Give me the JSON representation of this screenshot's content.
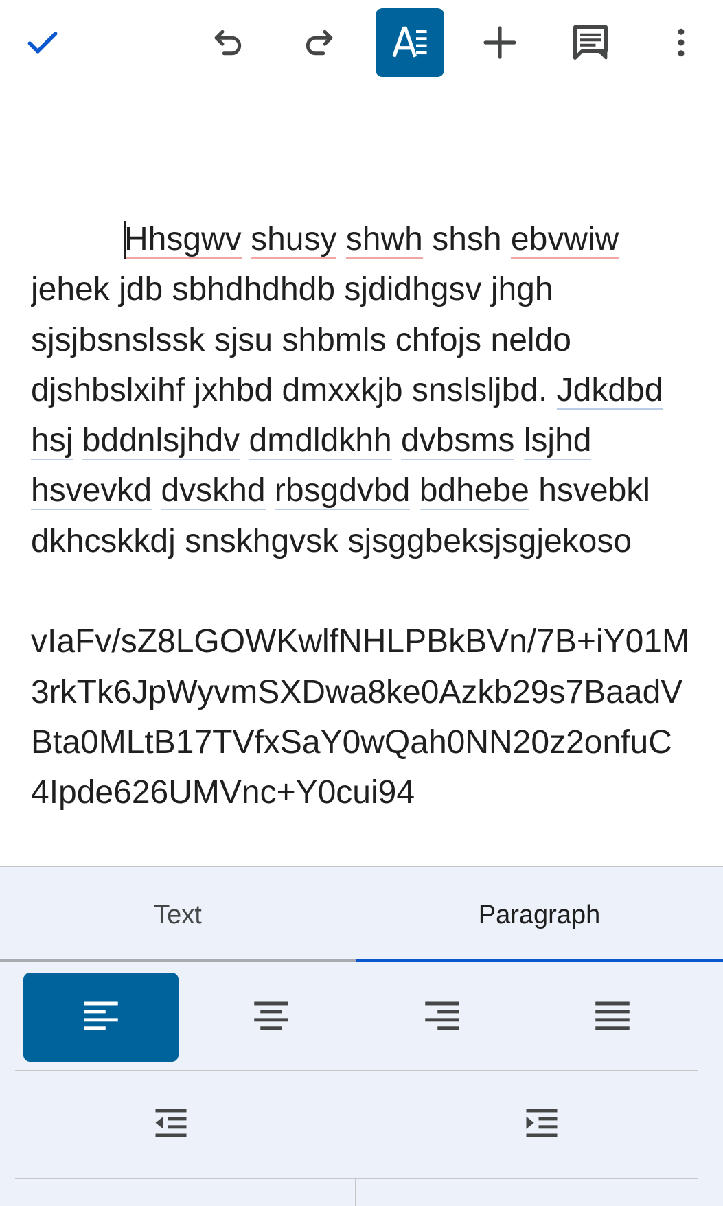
{
  "toolbar": {
    "icons": [
      "check-icon",
      "undo-icon",
      "redo-icon",
      "text-format-icon",
      "add-icon",
      "comment-icon",
      "more-vert-icon"
    ],
    "accent_color": "#00639b"
  },
  "document": {
    "para1": {
      "w1": "Hhsgwv",
      "s1": " ",
      "w2": "shusy",
      "s2": " ",
      "w3": "shwh",
      "t1": " shsh ",
      "w4": "ebvwiw",
      "t2": " jehek jdb sbhdhdhdb sjdidhgsv jhgh sjsjbsnslssk sjsu shbmls chfojs neldo djshbslxihf jxhbd dmxxkjb snslsljbd. ",
      "g1": "Jdkdbd",
      "gs1": " ",
      "g2": "hsj",
      "gs2": " ",
      "g3": "bddnlsjhdv",
      "gs3": " ",
      "g4": "dmdldkhh",
      "gs4": " ",
      "g5": "dvbsms",
      "gs5": " ",
      "g6": "lsjhd",
      "gs6": " ",
      "g7": "hsvevkd",
      "gs7": " ",
      "g8": "dvskhd",
      "gs8": " ",
      "g9": "rbsgdvbd",
      "gs9": " ",
      "g10": "bdhebe",
      "t3": " hsvebkl dkhcskkdj snskhgvsk sjsggbeksjsgjekoso"
    },
    "para2": "vIaFv/sZ8LGOWKwlfNHLPBkBVn/7B+iY01M3rkTk6JpWyvmSXDwa8ke0Azkb29s7BaadVBta0MLtB17TVfxSaY0wQah0NN20z2onfuC4Ipde626UMVnc+Y0cui94"
  },
  "panel": {
    "tabs": [
      {
        "label": "Text",
        "selected": false
      },
      {
        "label": "Paragraph",
        "selected": true
      }
    ],
    "alignment": {
      "options": [
        "align-left-icon",
        "align-center-icon",
        "align-right-icon",
        "align-justify-icon"
      ],
      "selected": "align-left-icon"
    },
    "indent": [
      "indent-decrease-icon",
      "indent-increase-icon"
    ],
    "selected_tab_color": "#0b57d0"
  }
}
